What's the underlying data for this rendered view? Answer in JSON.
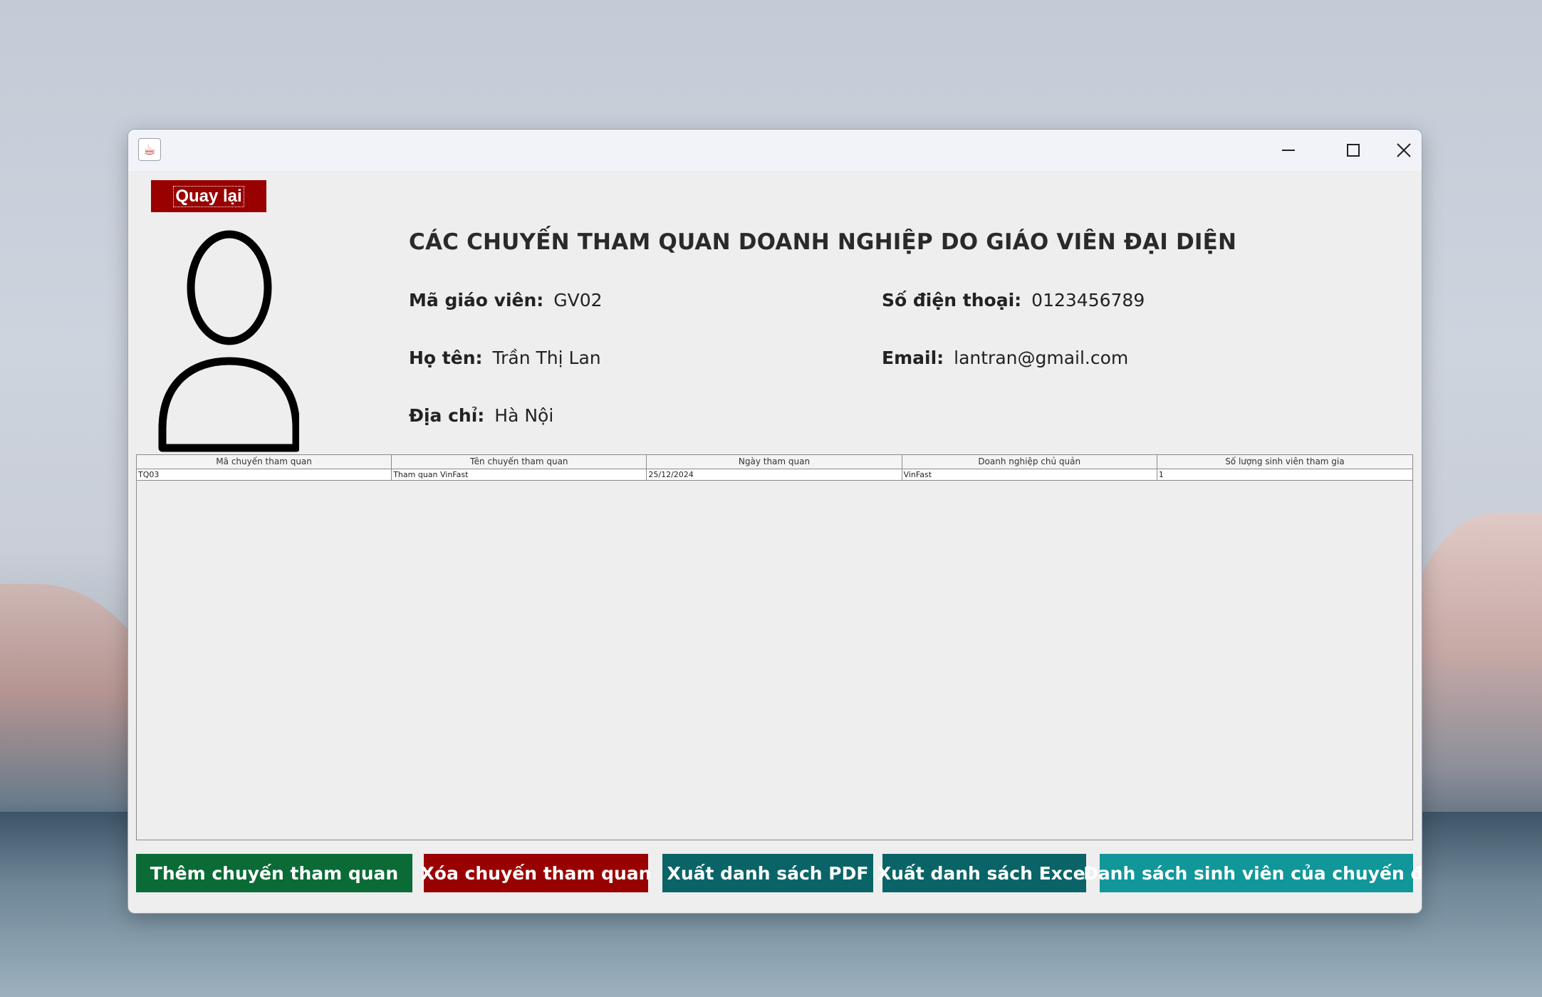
{
  "window": {
    "app_icon": "java-cup-icon",
    "controls": {
      "minimize": "minimize-icon",
      "maximize": "maximize-icon",
      "close": "close-icon"
    }
  },
  "back_button": {
    "label": "Quay lại"
  },
  "heading": "CÁC CHUYẾN THAM QUAN DOANH NGHIỆP DO GIÁO VIÊN ĐẠI DIỆN",
  "teacher": {
    "id_label": "Mã giáo viên:",
    "id_value": "GV02",
    "phone_label": "Số điện thoại:",
    "phone_value": "0123456789",
    "name_label": "Họ tên:",
    "name_value": "Trần Thị Lan",
    "email_label": "Email:",
    "email_value": "lantran@gmail.com",
    "address_label": "Địa chỉ:",
    "address_value": "Hà Nội"
  },
  "table": {
    "columns": [
      "Mã chuyến tham quan",
      "Tên chuyến tham quan",
      "Ngày tham quan",
      "Doanh nghiệp chủ quản",
      "Số lượng sinh viên tham gia"
    ],
    "rows": [
      [
        "TQ03",
        "Tham quan VinFast",
        "25/12/2024",
        "VinFast",
        "1"
      ]
    ]
  },
  "actions": {
    "add": "Thêm chuyến tham quan",
    "delete": "Xóa chuyến tham quan",
    "export_pdf": "Xuất danh sách PDF",
    "export_excel": "Xuất danh sách Excel",
    "students": "Danh sách sinh viên của chuyến đi"
  },
  "colors": {
    "back": "#990000",
    "add": "#0b6b36",
    "delete": "#990000",
    "export_pdf": "#0a6467",
    "export_excel": "#0a6467",
    "students": "#11979a"
  }
}
